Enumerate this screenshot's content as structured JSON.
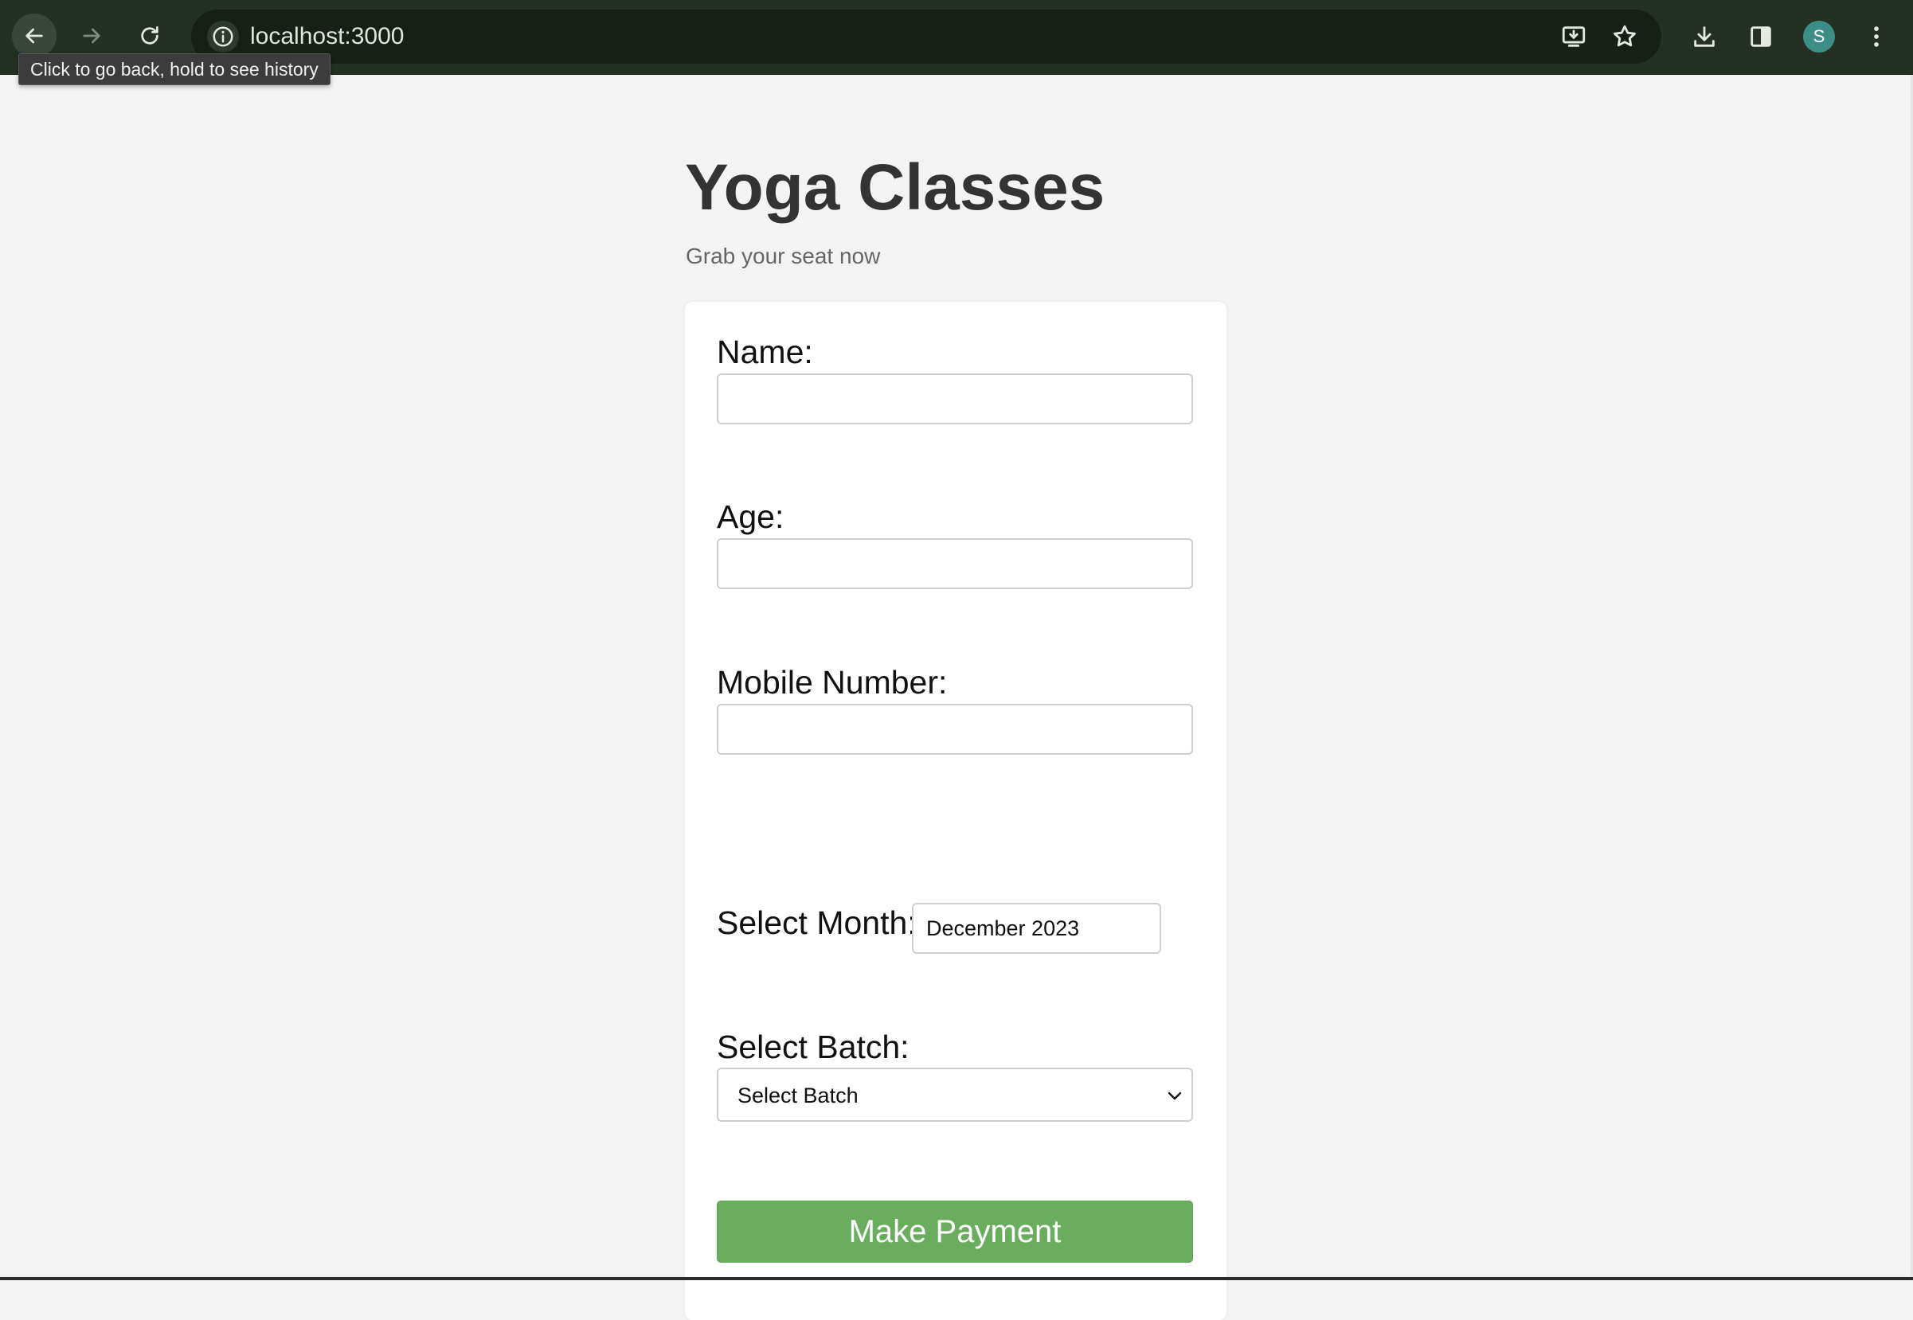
{
  "browser": {
    "url": "localhost:3000",
    "tooltip": "Click to go back, hold to see history",
    "profile_initial": "S"
  },
  "page": {
    "title": "Yoga Classes",
    "subtitle": "Grab your seat now"
  },
  "form": {
    "name_label": "Name:",
    "name_value": "",
    "age_label": "Age:",
    "age_value": "",
    "mobile_label": "Mobile Number:",
    "mobile_value": "",
    "month_label": "Select Month:",
    "month_value": "December 2023",
    "batch_label": "Select Batch:",
    "batch_selected": "Select Batch",
    "submit_label": "Make Payment"
  },
  "colors": {
    "browser_toolbar": "#243023",
    "page_background": "#f3f3f3",
    "card_background": "#ffffff",
    "submit_button": "#6aad5e",
    "avatar": "#3d8d87"
  }
}
